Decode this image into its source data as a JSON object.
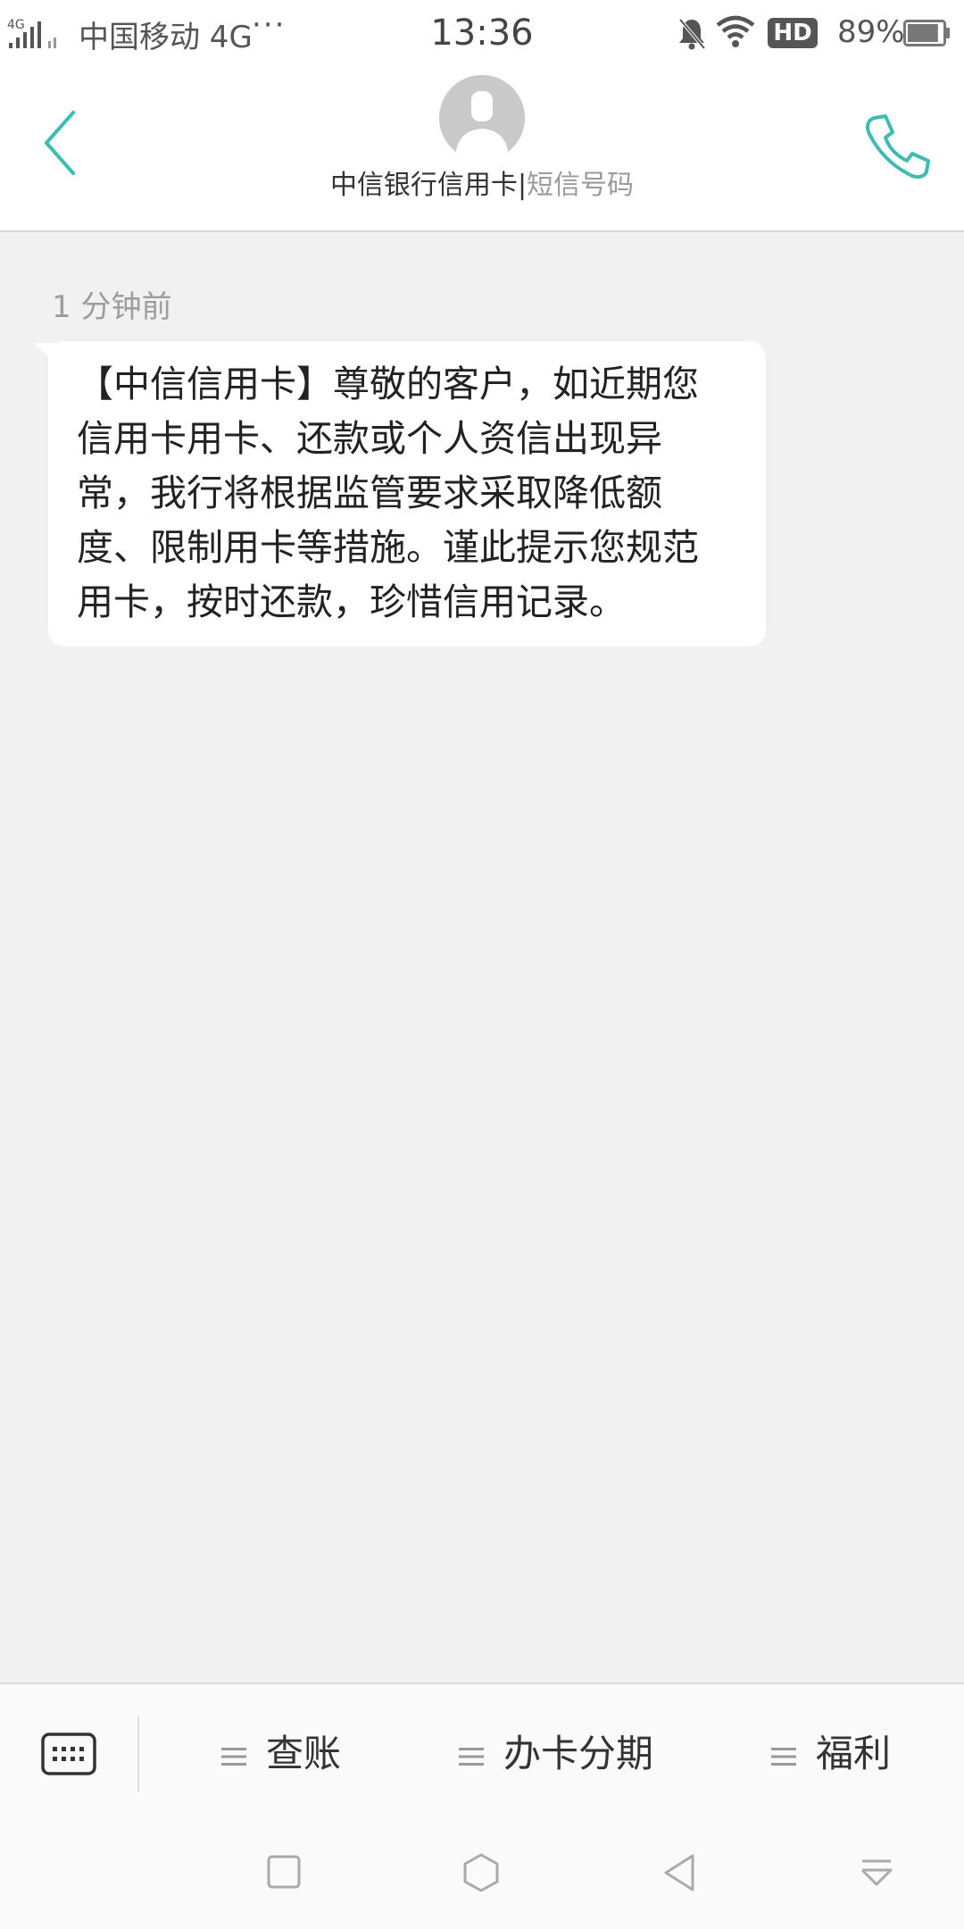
{
  "status_bar": {
    "network_badge": "4G",
    "carrier": "中国移动 4G",
    "more": "···",
    "time": "13:36",
    "hd": "HD",
    "battery_percent": "89%",
    "battery_level": 0.89
  },
  "header": {
    "contact_name": "中信银行信用卡",
    "separator": "|",
    "contact_sub": "短信号码",
    "accent_color": "#3dbdb1"
  },
  "conversation": {
    "timestamp": "1 分钟前",
    "message": "【中信信用卡】尊敬的客户，如近期您\n信用卡用卡、还款或个人资信出现异\n常，我行将根据监管要求采取降低额\n度、限制用卡等措施。谨此提示您规范\n用卡，按时还款，珍惜信用记录。"
  },
  "menu": {
    "items": [
      {
        "label": "查账"
      },
      {
        "label": "办卡分期"
      },
      {
        "label": "福利"
      }
    ]
  },
  "icons": {
    "back": "chevron-left-icon",
    "call": "phone-icon",
    "avatar": "person-icon",
    "keyboard": "keyboard-icon",
    "menu": "hamburger-icon",
    "nav": [
      "square-icon",
      "hexagon-icon",
      "triangle-back-icon",
      "notification-shade-icon"
    ]
  }
}
